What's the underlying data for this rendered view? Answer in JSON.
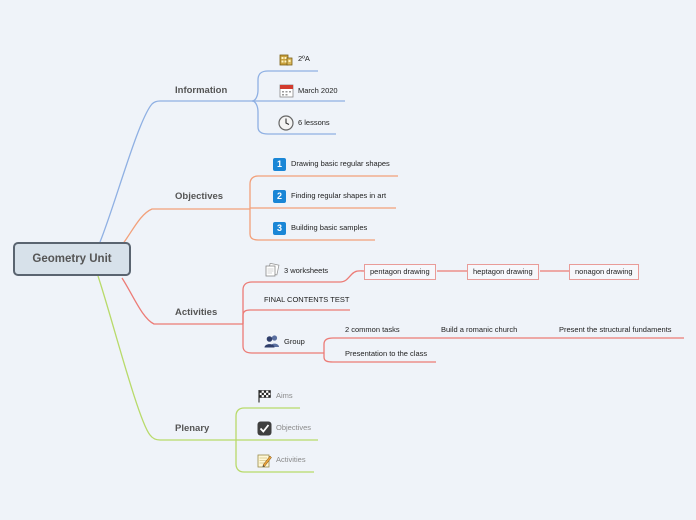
{
  "root": {
    "label": "Geometry Unit"
  },
  "branches": {
    "information": {
      "label": "Information",
      "color": "#8fb0e3",
      "items": [
        {
          "icon": "building-icon",
          "label": "2ºA"
        },
        {
          "icon": "calendar-icon",
          "label": "March 2020"
        },
        {
          "icon": "clock-icon",
          "label": "6 lessons"
        }
      ]
    },
    "objectives": {
      "label": "Objectives",
      "color": "#f2a07a",
      "items": [
        {
          "icon": "number-1-icon",
          "num": "1",
          "label": "Drawing basic regular shapes"
        },
        {
          "icon": "number-2-icon",
          "num": "2",
          "label": "Finding regular shapes in art"
        },
        {
          "icon": "number-3-icon",
          "num": "3",
          "label": "Building basic samples"
        }
      ]
    },
    "activities": {
      "label": "Activities",
      "color": "#ec7b76",
      "worksheets": {
        "label": "3 worksheets",
        "icon": "worksheets-icon",
        "children": [
          "pentagon drawing",
          "heptagon drawing",
          "nonagon drawing"
        ]
      },
      "test": {
        "label": "FINAL CONTENTS TEST"
      },
      "group": {
        "label": "Group",
        "icon": "people-icon",
        "tasks": {
          "label": "2 common tasks",
          "chain": [
            "Build a romanic church",
            "Present the structural fundaments"
          ]
        },
        "presentation": {
          "label": "Presentation to the class"
        }
      }
    },
    "plenary": {
      "label": "Plenary",
      "color": "#b8da6a",
      "items": [
        {
          "icon": "checkered-flag-icon",
          "label": "Aims"
        },
        {
          "icon": "checkbox-icon",
          "label": "Objectives"
        },
        {
          "icon": "notepad-pencil-icon",
          "label": "Activities"
        }
      ]
    }
  }
}
